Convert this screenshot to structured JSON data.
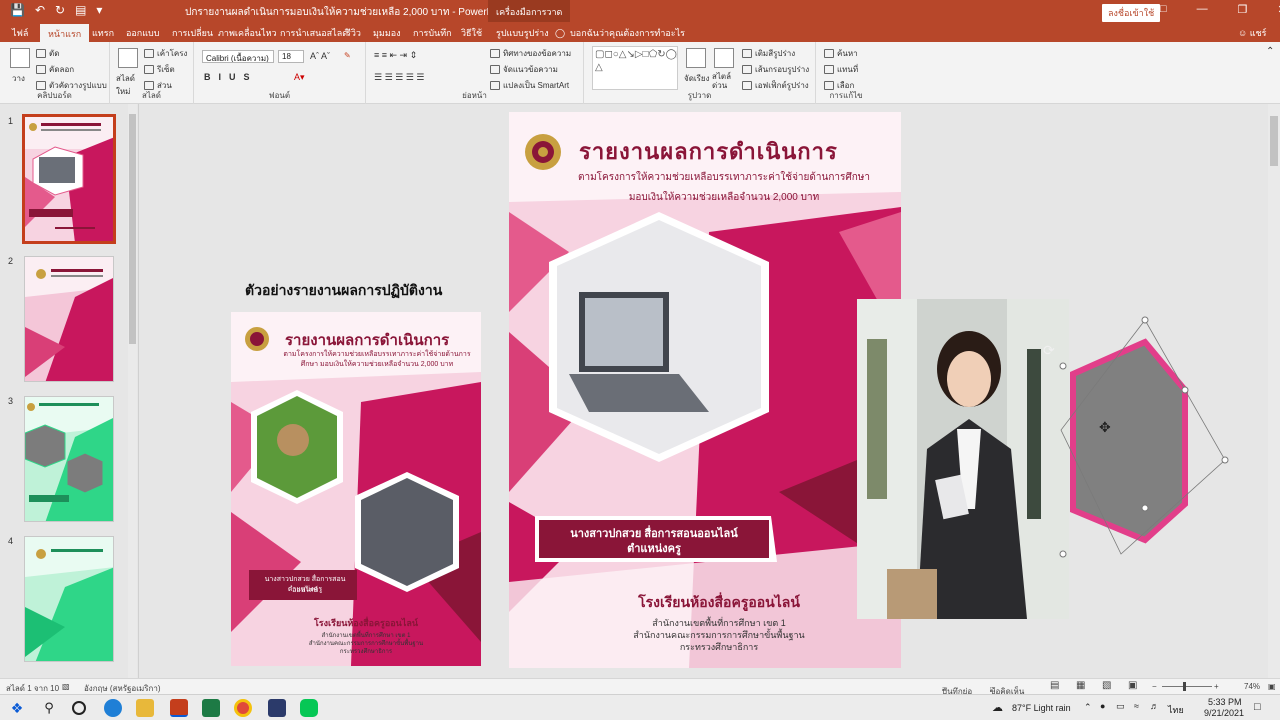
{
  "window": {
    "document_title": "ปกรายงานผลดำเนินการมอบเงินให้ความช่วยเหลือ 2,000 บาท  -  PowerPoint",
    "context_tab": "เครื่องมือการวาด",
    "sign_in": "ลงชื่อเข้าใช้"
  },
  "tabs": [
    "ไฟล์",
    "หน้าแรก",
    "แทรก",
    "ออกแบบ",
    "การเปลี่ยน",
    "ภาพเคลื่อนไหว",
    "การนำเสนอสไลด์",
    "รีวิว",
    "มุมมอง",
    "การบันทึก",
    "วิธีใช้",
    "รูปแบบรูปร่าง"
  ],
  "search_tab": "บอกฉันว่าคุณต้องการทำอะไร",
  "share_label": "แชร์",
  "ribbon": {
    "clipboard": {
      "paste": "วาง",
      "cut": "ตัด",
      "copy": "คัดลอก",
      "format_painter": "ตัวคัดวางรูปแบบ",
      "label": "คลิปบอร์ด"
    },
    "slides": {
      "new_slide": "สไลด์ใหม่",
      "layout": "เค้าโครง",
      "reset": "รีเซ็ต",
      "section": "ส่วน",
      "label": "สไลด์"
    },
    "font": {
      "font_name": "Calibri (เนื้อความ)",
      "font_size": "18",
      "label": "ฟอนต์"
    },
    "paragraph": {
      "text_direction": "ทิศทางของข้อความ",
      "align_text": "จัดแนวข้อความ",
      "smartart": "แปลงเป็น SmartArt",
      "label": "ย่อหน้า"
    },
    "drawing": {
      "arrange": "จัดเรียง",
      "quick_styles": "สไตล์ด่วน",
      "shape_fill": "เติมสีรูปร่าง",
      "shape_outline": "เส้นกรอบรูปร่าง",
      "shape_effects": "เอฟเฟ็กต์รูปร่าง",
      "label": "รูปวาด"
    },
    "editing": {
      "find": "ค้นหา",
      "replace": "แทนที่",
      "select": "เลือก",
      "label": "การแก้ไข"
    }
  },
  "thumbnails": [
    {
      "number": "1",
      "selected": true
    },
    {
      "number": "2",
      "selected": false
    },
    {
      "number": "3",
      "selected": false
    },
    {
      "number": "4",
      "selected": false
    }
  ],
  "slide": {
    "heading": "ตัวอย่างรายงานผลการปฏิบัติงาน",
    "example": {
      "title": "รายงานผลการดำเนินการ",
      "subtitle": "ตามโครงการให้ความช่วยเหลือบรรเทาภาระค่าใช้จ่ายด้านการศึกษา มอบเงินให้ความช่วยเหลือจำนวน 2,000 บาท",
      "name_line1": "นางสาวปกสวย สื่อการสอนออนไลน์",
      "name_line2": "ตำแหน่งครู",
      "school": "โรงเรียนห้องสื่อครูออนไลน์",
      "office1": "สำนักงานเขตพื้นที่การศึกษา เขต 1",
      "office2": "สำนักงานคณะกรรมการการศึกษาขั้นพื้นฐาน",
      "office3": "กระทรวงศึกษาธิการ"
    },
    "main": {
      "title": "รายงานผลการดำเนินการ",
      "subtitle1": "ตามโครงการให้ความช่วยเหลือบรรเทาภาระค่าใช้จ่ายด้านการศึกษา",
      "subtitle2": "มอบเงินให้ความช่วยเหลือจำนวน 2,000 บาท",
      "name_line1": "นางสาวปกสวย  สื่อการสอนออนไลน์",
      "name_line2": "ตำแหน่งครู",
      "school": "โรงเรียนห้องสื่อครูออนไลน์",
      "office1": "สำนักงานเขตพื้นที่การศึกษา เขต 1",
      "office2": "สำนักงานคณะกรรมการการศึกษาขั้นพื้นฐาน",
      "office3": "กระทรวงศึกษาธิการ"
    }
  },
  "status": {
    "slide_count": "สไลด์ 1 จาก 10",
    "language": "อังกฤษ (สหรัฐอเมริกา)",
    "notes": "บันทึกย่อ",
    "comments": "ข้อคิดเห็น",
    "zoom": "74%"
  },
  "taskbar": {
    "weather": "87°F  Light rain",
    "ime": "ไทย",
    "time": "5:33 PM",
    "date": "9/21/2021"
  },
  "colors": {
    "accent": "#b7472a",
    "magenta": "#c8175d",
    "maroon": "#8a1538",
    "selection": "#c43e1c"
  }
}
